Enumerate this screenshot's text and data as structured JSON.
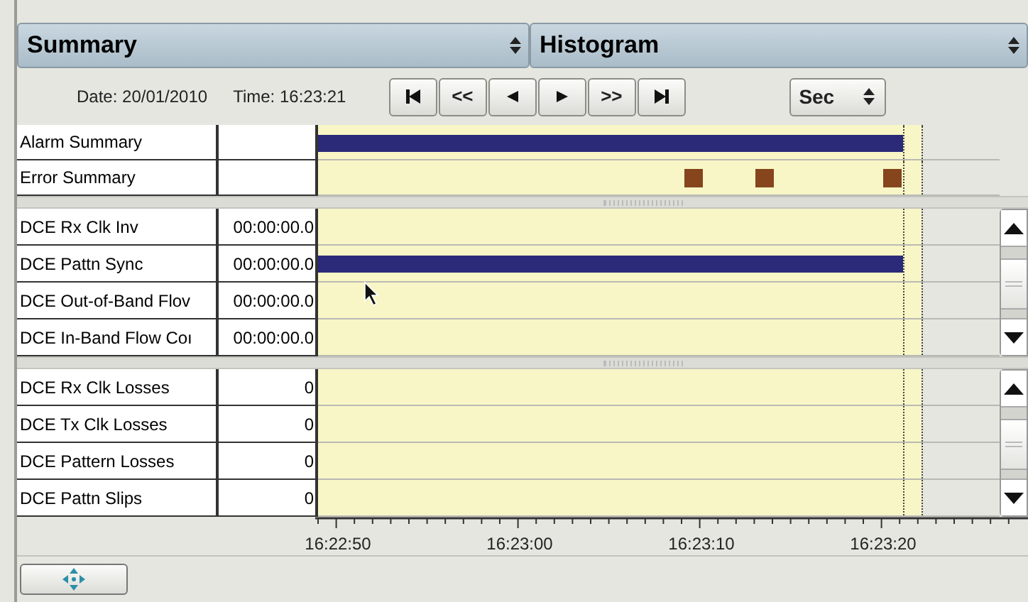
{
  "view_selectors": [
    {
      "label": "Summary"
    },
    {
      "label": "Histogram"
    }
  ],
  "toolbar": {
    "date": "Date: 20/01/2010",
    "time": "Time: 16:23:21",
    "nav_buttons": [
      {
        "kind": "first"
      },
      {
        "kind": "rewind",
        "label": "<<"
      },
      {
        "kind": "back"
      },
      {
        "kind": "play"
      },
      {
        "kind": "forward",
        "label": ">>"
      },
      {
        "kind": "last"
      }
    ],
    "unit": "Sec"
  },
  "summary_rows": [
    {
      "name": "Alarm Summary",
      "kind": "bar"
    },
    {
      "name": "Error Summary",
      "kind": "markers"
    }
  ],
  "groups": [
    {
      "rows": [
        {
          "name": "DCE Rx Clk Inv",
          "value": "00:00:00.0",
          "kind": "empty"
        },
        {
          "name": "DCE Pattn Sync",
          "value": "00:00:00.0",
          "kind": "bar"
        },
        {
          "name": "DCE Out-of-Band Flov",
          "value": "00:00:00.0",
          "kind": "empty"
        },
        {
          "name": "DCE In-Band Flow Coı",
          "value": "00:00:00.0",
          "kind": "empty"
        }
      ]
    },
    {
      "rows": [
        {
          "name": "DCE Rx Clk Losses",
          "value": "0",
          "kind": "empty"
        },
        {
          "name": "DCE Tx Clk Losses",
          "value": "0",
          "kind": "empty"
        },
        {
          "name": "DCE Pattern Losses",
          "value": "0",
          "kind": "empty"
        },
        {
          "name": "DCE Pattn Slips",
          "value": "0",
          "kind": "empty"
        }
      ]
    }
  ],
  "time_axis": [
    "16:22:50",
    "16:23:00",
    "16:23:10",
    "16:23:20"
  ]
}
